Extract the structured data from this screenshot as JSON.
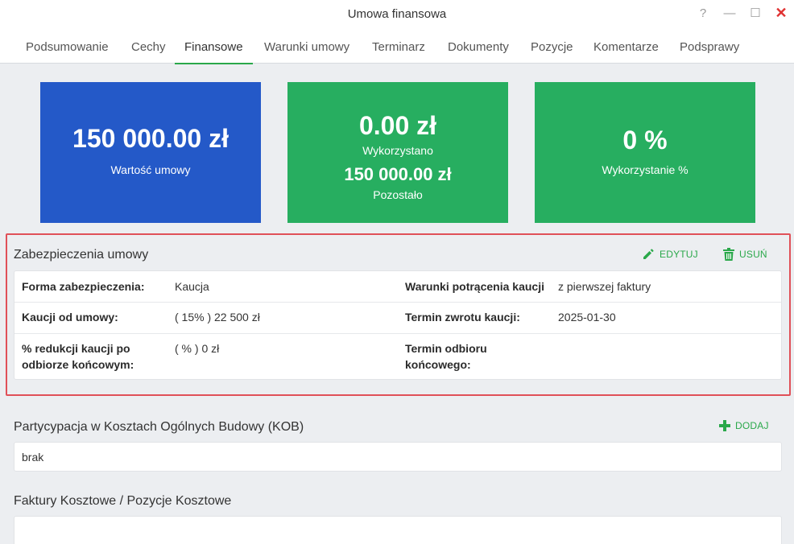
{
  "window": {
    "title": "Umowa finansowa",
    "help_icon": "?",
    "min_icon": "—",
    "max_icon": "☐",
    "close_icon": "✕"
  },
  "tabs": [
    {
      "label": "Podsumowanie"
    },
    {
      "label": "Cechy"
    },
    {
      "label": "Finansowe",
      "active": true
    },
    {
      "label": "Warunki umowy"
    },
    {
      "label": "Terminarz"
    },
    {
      "label": "Dokumenty"
    },
    {
      "label": "Pozycje"
    },
    {
      "label": "Komentarze"
    },
    {
      "label": "Podsprawy"
    }
  ],
  "cards": {
    "contract_value": {
      "value": "150 000.00 zł",
      "label": "Wartość umowy",
      "color": "#2459c8"
    },
    "usage": {
      "used_value": "0.00 zł",
      "used_label": "Wykorzystano",
      "remaining_value": "150 000.00 zł",
      "remaining_label": "Pozostało",
      "color": "#27ae60"
    },
    "usage_percent": {
      "value": "0 %",
      "label": "Wykorzystanie %",
      "color": "#27ae60"
    }
  },
  "security": {
    "title": "Zabezpieczenia umowy",
    "edit_label": "EDYTUJ",
    "delete_label": "USUŃ",
    "rows": {
      "form_label": "Forma zabezpieczenia:",
      "form_value": "Kaucja",
      "deduction_label": "Warunki potrącenia kaucji",
      "deduction_value": "z pierwszej faktury",
      "deposit_label": "Kaucji od umowy:",
      "deposit_value": "( 15% ) 22 500 zł",
      "return_label": "Termin zwrotu kaucji:",
      "return_value": "2025-01-30",
      "reduction_label_1": "% redukcji kaucji po",
      "reduction_label_2": "odbiorze końcowym:",
      "reduction_value": "( % ) 0 zł",
      "final_label_1": "Termin odbioru",
      "final_label_2": "końcowego:"
    }
  },
  "kob": {
    "title": "Partycypacja w Kosztach Ogólnych Budowy (KOB)",
    "add_label": "DODAJ",
    "value": "brak"
  },
  "invoices": {
    "title": "Faktury Kosztowe / Pozycje Kosztowe"
  },
  "colors": {
    "accent": "#2aa84a",
    "highlight": "#e05058"
  }
}
